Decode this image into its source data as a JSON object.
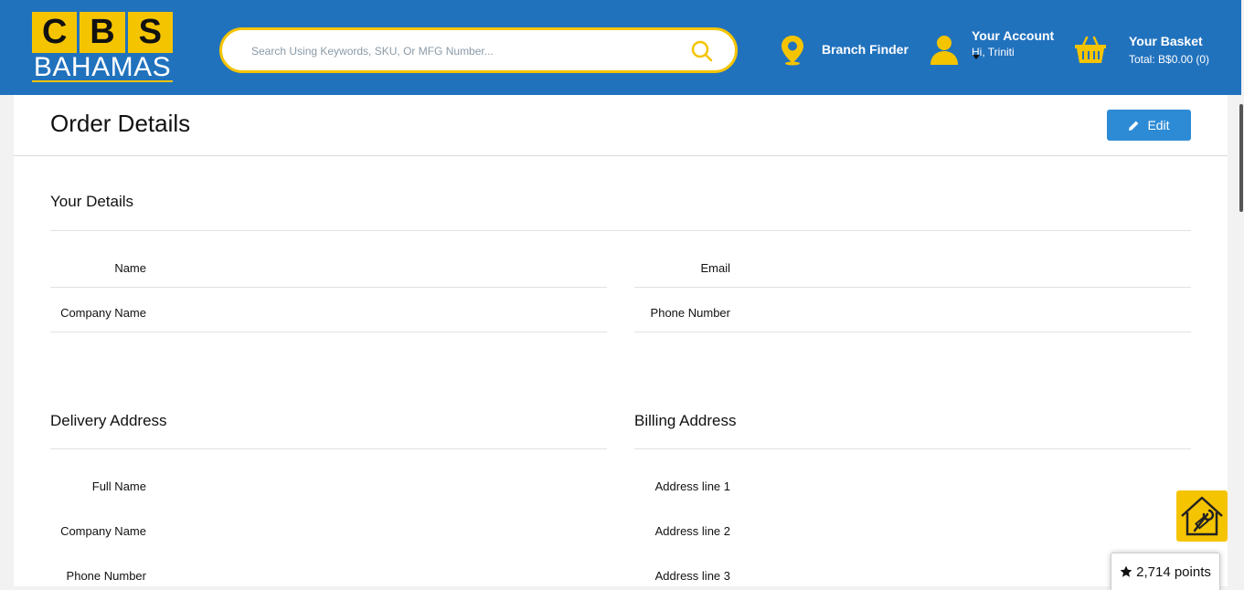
{
  "header": {
    "logo_top": [
      "C",
      "B",
      "S"
    ],
    "logo_bottom": "BAHAMAS",
    "search_placeholder": "Search Using Keywords, SKU, Or MFG Number...",
    "branch_finder": "Branch Finder",
    "account_title": "Your Account",
    "account_greeting": "Hi, Triniti",
    "basket_title": "Your Basket",
    "basket_total": "Total: B$0.00 (0)"
  },
  "page": {
    "title": "Order Details",
    "edit_label": "Edit"
  },
  "your_details": {
    "title": "Your Details",
    "name_label": "Name",
    "email_label": "Email",
    "company_label": "Company Name",
    "phone_label": "Phone Number"
  },
  "delivery": {
    "title": "Delivery Address",
    "full_name_label": "Full Name",
    "company_label": "Company Name",
    "phone_label": "Phone Number"
  },
  "billing": {
    "title": "Billing Address",
    "line1_label": "Address line 1",
    "line2_label": "Address line 2",
    "line3_label": "Address line 3"
  },
  "points": "2,714 points",
  "colors": {
    "header_bg": "#2172bd",
    "accent_yellow": "#f5c400",
    "edit_button": "#2d8bd6"
  },
  "icons": [
    "search-icon",
    "location-pin-icon",
    "user-icon",
    "basket-icon",
    "pencil-icon",
    "house-tools-icon",
    "star-icon"
  ]
}
